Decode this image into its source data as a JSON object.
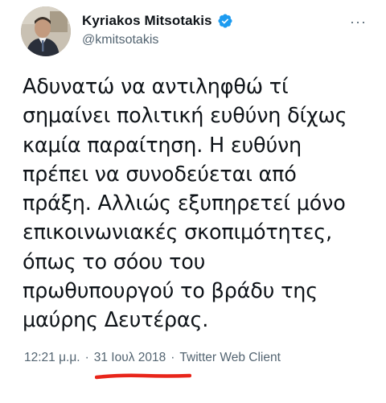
{
  "user": {
    "display_name": "Kyriakos Mitsotakis",
    "handle": "@kmitsotakis",
    "verified": true
  },
  "menu": {
    "more_label": "···"
  },
  "tweet": {
    "text": "Αδυνατώ να αντιληφθώ τί\nσημαίνει πολιτική ευθύνη δίχως\nκαμία παραίτηση. Η ευθύνη\nπρέπει να συνοδεύεται από\nπράξη. Αλλιώς εξυπηρετεί μόνο\nεπικοινωνιακές σκοπιμότητες,\nόπως το σόου του\nπρωθυπουργού το βράδυ της\nμαύρης Δευτέρας.",
    "time": "12:21 μ.μ.",
    "separator": "·",
    "date": "31 Ιουλ 2018",
    "client": "Twitter Web Client"
  },
  "colors": {
    "text": "#0f1419",
    "secondary": "#536471",
    "verified_blue": "#1d9bf0",
    "underline_red": "#e8251a"
  },
  "icons": {
    "verified": "verified-badge-icon",
    "more": "more-options-icon"
  }
}
